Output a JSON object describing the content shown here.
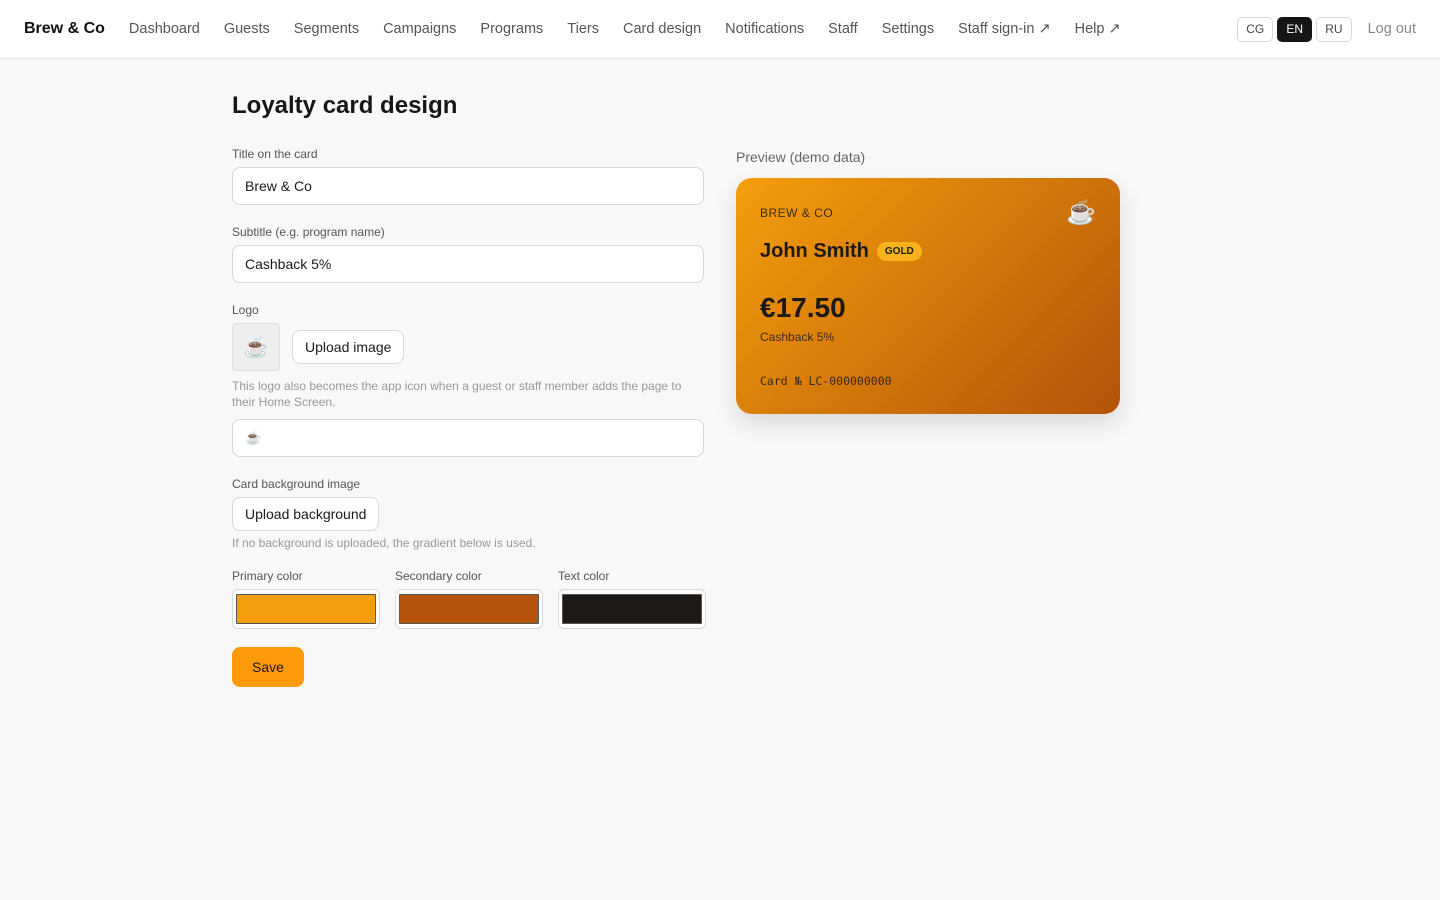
{
  "header": {
    "brand": "Brew & Co",
    "nav": [
      {
        "label": "Dashboard"
      },
      {
        "label": "Guests"
      },
      {
        "label": "Segments"
      },
      {
        "label": "Campaigns"
      },
      {
        "label": "Programs"
      },
      {
        "label": "Tiers"
      },
      {
        "label": "Card design"
      },
      {
        "label": "Notifications"
      },
      {
        "label": "Staff"
      },
      {
        "label": "Settings"
      },
      {
        "label": "Staff sign-in ↗"
      },
      {
        "label": "Help ↗"
      }
    ],
    "languages": [
      {
        "code": "CG",
        "active": false
      },
      {
        "code": "EN",
        "active": true
      },
      {
        "code": "RU",
        "active": false
      }
    ],
    "logout": "Log out"
  },
  "page": {
    "title": "Loyalty card design"
  },
  "form": {
    "title_label": "Title on the card",
    "title_value": "Brew & Co",
    "subtitle_label": "Subtitle (e.g. program name)",
    "subtitle_value": "Cashback 5%",
    "logo_label": "Logo",
    "logo_emoji": "☕",
    "upload_image": "Upload image",
    "logo_hint": "This logo also becomes the app icon when a guest or staff member adds the page to their Home Screen.",
    "logo_input_value": "☕",
    "bg_label": "Card background image",
    "upload_background": "Upload background",
    "bg_hint": "If no background is uploaded, the gradient below is used.",
    "primary_label": "Primary color",
    "secondary_label": "Secondary color",
    "text_label": "Text color",
    "save": "Save"
  },
  "colors": {
    "primary": "#f59e0b",
    "secondary": "#b45309",
    "text": "#1c1917",
    "save_button": "#ff9a0a"
  },
  "preview": {
    "label": "Preview (demo data)",
    "brand": "BREW & CO",
    "logo": "☕",
    "name": "John Smith",
    "tier": "GOLD",
    "balance": "€17.50",
    "subtitle": "Cashback 5%",
    "card_number": "Card № LC-000000000"
  }
}
